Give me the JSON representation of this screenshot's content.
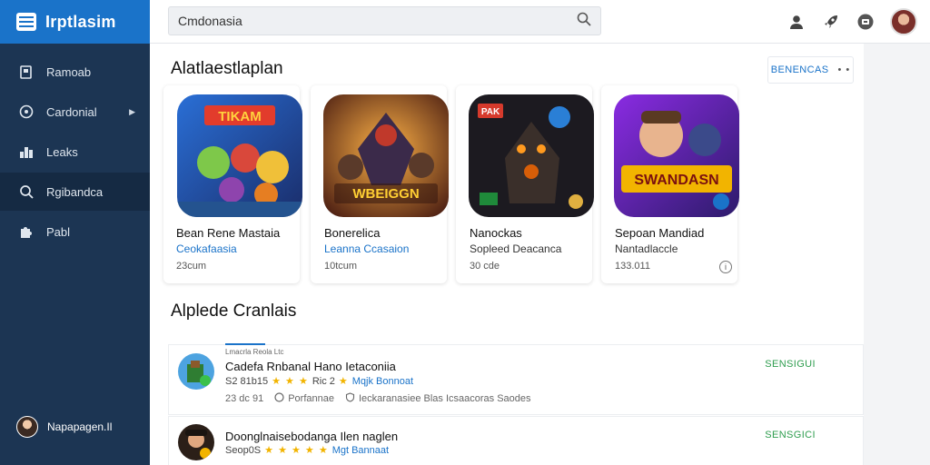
{
  "app": {
    "name": "Irptlasim"
  },
  "sidebar": {
    "items": [
      {
        "label": "Ramoab",
        "icon": "book-icon"
      },
      {
        "label": "Cardonial",
        "icon": "compass-icon",
        "chevron": true
      },
      {
        "label": "Leaks",
        "icon": "chart-icon"
      },
      {
        "label": "Rgibandca",
        "icon": "search-icon",
        "active": true
      },
      {
        "label": "Pabl",
        "icon": "puzzle-icon"
      }
    ],
    "user": {
      "name": "Napapagen.Il"
    }
  },
  "topbar": {
    "search": {
      "value": "Cmdonasia"
    },
    "icons": [
      "account-icon",
      "rocket-icon",
      "badge-icon",
      "user-avatar"
    ]
  },
  "featured": {
    "title": "Alatlaestlaplan",
    "see_all": "BENENCAS",
    "cards": [
      {
        "title": "Bean Rene Mastaia",
        "subtitle": "Ceokafaasia",
        "subtitle_color": "blue",
        "meta": "23cum",
        "art_text": "TIKAM"
      },
      {
        "title": "Bonerelica",
        "subtitle": "Leanna Ccasaion",
        "subtitle_color": "blue",
        "meta": "10tcum",
        "art_text": "WBEIGGN"
      },
      {
        "title": "Nanockas",
        "subtitle": "Sopleed Deacanca",
        "subtitle_color": "dark",
        "meta": "30 cde",
        "art_text": "PAK"
      },
      {
        "title": "Sepoan Mandiad",
        "subtitle": "Nantadlaccle",
        "subtitle_color": "dark",
        "meta": "133.011",
        "art_text": "SWANDASN",
        "info": true
      }
    ]
  },
  "updates": {
    "title": "Alplede Cranlais",
    "tab_label": "Lmacrla Reola Ltc",
    "items": [
      {
        "title": "Cadefa Rnbanal Hano Ietaconiia",
        "rating_value": "S2 81b15",
        "stars": "★ ★ ★",
        "rating_text": "Ric 2",
        "rating_link": "Mqjk Bonnoat",
        "meta_size": "23 dc 91",
        "meta_a": "Porfannae",
        "meta_b": "Ieckaranasiee Blas Icsaacoras Saodes",
        "action": "SENSIGUI"
      },
      {
        "title": "Doonglnaisebodanga Ilen naglen",
        "rating_value": "Seop0S",
        "stars": "★ ★ ★ ★ ★",
        "rating_text": "",
        "rating_link": "Mgt Bannaat",
        "meta_size": "",
        "meta_a": "",
        "meta_b": "",
        "action": "SENSGICI"
      }
    ]
  }
}
